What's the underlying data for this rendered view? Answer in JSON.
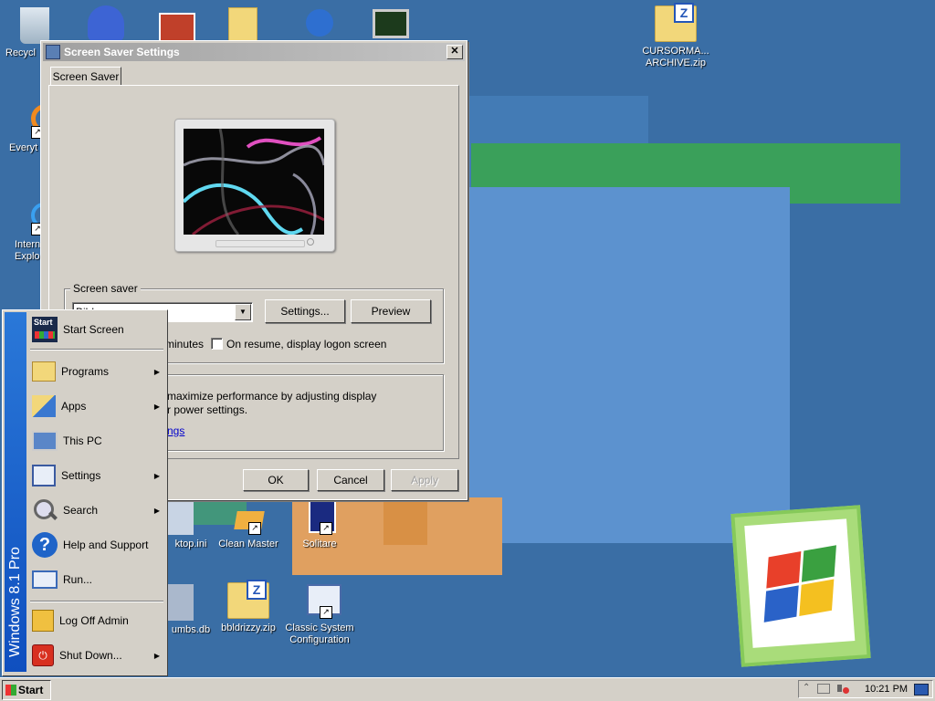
{
  "desktop": {
    "icons": [
      {
        "label": "Recycl",
        "icon": "recycle-bin-icon"
      },
      {
        "label": "Everyt",
        "icon": "everything-search-icon"
      },
      {
        "label": "Intern\nExplo",
        "icon": "internet-explorer-icon"
      },
      {
        "label": "CURSORMA...\nARCHIVE.zip",
        "icon": "zip-folder-icon"
      },
      {
        "label": "ktop.ini",
        "icon": "settings-file-icon"
      },
      {
        "label": "Clean Master",
        "icon": "broom-icon"
      },
      {
        "label": "Solitare",
        "icon": "cards-icon"
      },
      {
        "label": "umbs.db",
        "icon": "database-file-icon"
      },
      {
        "label": "bbldrizzy.zip",
        "icon": "zip-folder-icon"
      },
      {
        "label": "Classic System\nConfiguration",
        "icon": "system-config-icon"
      }
    ]
  },
  "dialog": {
    "title": "Screen Saver Settings",
    "tab_label": "Screen Saver",
    "screensaver_group_title": "Screen saver",
    "selected_screensaver": "Bibl",
    "settings_button": "Settings...",
    "preview_button": "Preview",
    "wait_text": "minutes",
    "resume_label": "On resume, display logon screen",
    "resume_checked": false,
    "power_text_1": "maximize performance by adjusting display",
    "power_text_2": "r power settings.",
    "power_link": "ngs",
    "ok_button": "OK",
    "cancel_button": "Cancel",
    "apply_button": "Apply"
  },
  "start_menu": {
    "band_text": "Windows 8.1 Pro",
    "items": [
      {
        "label": "Start Screen",
        "icon": "start-screen-icon",
        "submenu": false
      },
      {
        "label": "Programs",
        "icon": "programs-icon",
        "submenu": true
      },
      {
        "label": "Apps",
        "icon": "apps-icon",
        "submenu": true
      },
      {
        "label": "This PC",
        "icon": "computer-icon",
        "submenu": false
      },
      {
        "label": "Settings",
        "icon": "settings-icon",
        "submenu": true
      },
      {
        "label": "Search",
        "icon": "search-icon",
        "submenu": true
      },
      {
        "label": "Help and Support",
        "icon": "help-icon",
        "submenu": false
      },
      {
        "label": "Run...",
        "icon": "run-icon",
        "submenu": false
      },
      {
        "label": "Log Off Admin",
        "icon": "log-off-icon",
        "submenu": false
      },
      {
        "label": "Shut Down...",
        "icon": "shut-down-icon",
        "submenu": true
      }
    ],
    "start_screen_tile_label": "Start"
  },
  "taskbar": {
    "start_label": "Start",
    "clock": "10:21 PM"
  }
}
